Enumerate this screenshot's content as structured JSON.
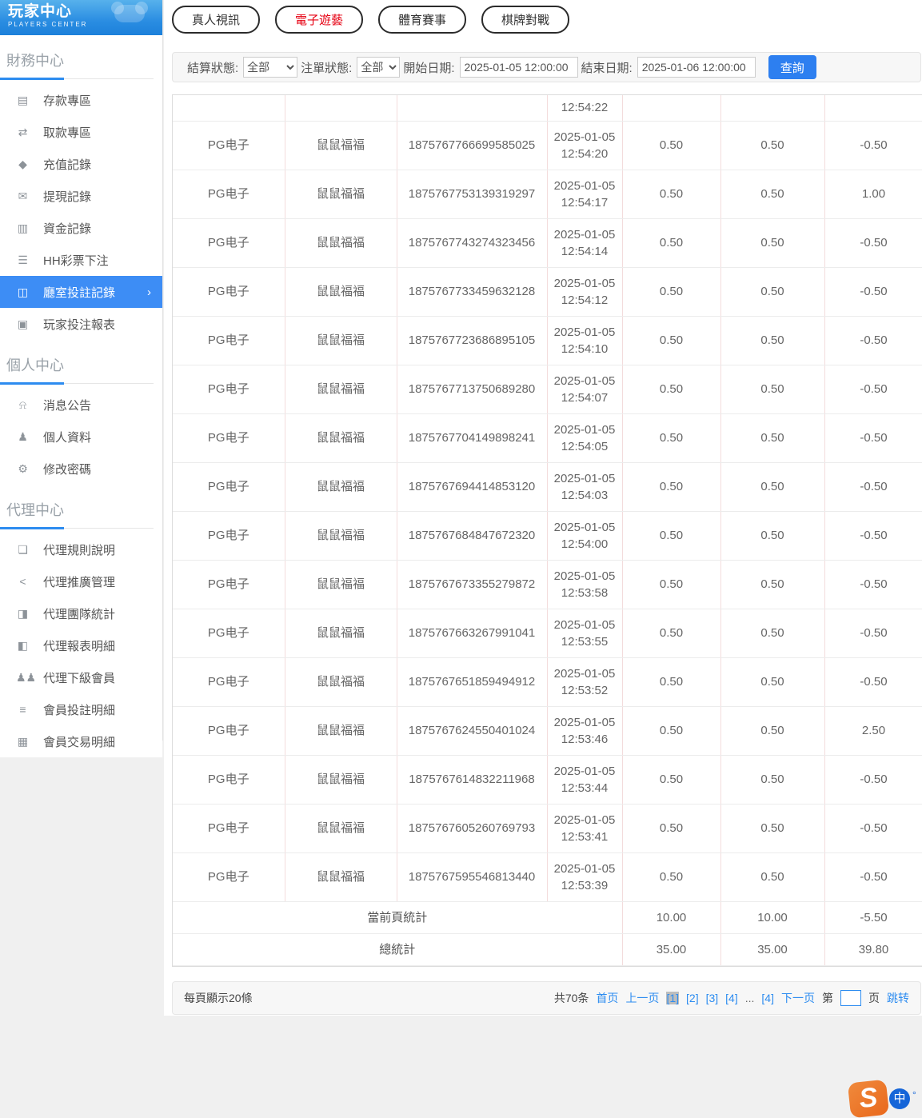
{
  "brand": {
    "title": "玩家中心",
    "subtitle": "PLAYERS CENTER"
  },
  "sidebar": {
    "sections": [
      {
        "title": "財務中心",
        "items": [
          {
            "id": "deposit",
            "label": "存款專區",
            "icon": "bank-card-icon",
            "active": false
          },
          {
            "id": "withdraw",
            "label": "取款專區",
            "icon": "hand-money-icon",
            "active": false
          },
          {
            "id": "recharge-record",
            "label": "充值記錄",
            "icon": "money-bag-icon",
            "active": false
          },
          {
            "id": "withdraw-record",
            "label": "提現記錄",
            "icon": "wallet-icon",
            "active": false
          },
          {
            "id": "funds-record",
            "label": "資金記錄",
            "icon": "coin-purse-icon",
            "active": false
          },
          {
            "id": "hh-lottery",
            "label": "HH彩票下注",
            "icon": "ticket-list-icon",
            "active": false
          },
          {
            "id": "hall-bet-record",
            "label": "廳室投註記錄",
            "icon": "layout-list-icon",
            "active": true
          },
          {
            "id": "player-bet-report",
            "label": "玩家投注報表",
            "icon": "report-chart-icon",
            "active": false
          }
        ]
      },
      {
        "title": "個人中心",
        "items": [
          {
            "id": "messages",
            "label": "消息公告",
            "icon": "bell-icon",
            "active": false
          },
          {
            "id": "profile",
            "label": "個人資料",
            "icon": "person-icon",
            "active": false
          },
          {
            "id": "change-password",
            "label": "修改密碼",
            "icon": "gear-icon",
            "active": false
          }
        ]
      },
      {
        "title": "代理中心",
        "items": [
          {
            "id": "agent-rules",
            "label": "代理規則說明",
            "icon": "document-icon",
            "active": false
          },
          {
            "id": "agent-promotion",
            "label": "代理推廣管理",
            "icon": "share-icon",
            "active": false
          },
          {
            "id": "agent-team-stats",
            "label": "代理團隊統計",
            "icon": "team-stats-icon",
            "active": false
          },
          {
            "id": "agent-report-detail",
            "label": "代理報表明細",
            "icon": "report-detail-icon",
            "active": false
          },
          {
            "id": "agent-sub-members",
            "label": "代理下級會員",
            "icon": "users-icon",
            "active": false
          },
          {
            "id": "member-bet-detail",
            "label": "會員投註明細",
            "icon": "clipboard-list-icon",
            "active": false
          },
          {
            "id": "member-transaction-detail",
            "label": "會員交易明細",
            "icon": "ledger-icon",
            "active": false
          }
        ]
      }
    ]
  },
  "tabs": [
    {
      "id": "live-video",
      "label": "真人視訊",
      "active": false
    },
    {
      "id": "electronic-games",
      "label": "電子遊藝",
      "active": true
    },
    {
      "id": "sports",
      "label": "體育賽事",
      "active": false
    },
    {
      "id": "board-games",
      "label": "棋牌對戰",
      "active": false
    }
  ],
  "filters": {
    "settle_label": "結算狀態:",
    "settle_value": "全部",
    "order_label": "注單狀態:",
    "order_value": "全部",
    "start_label": "開始日期:",
    "start_value": "2025-01-05 12:00:00",
    "end_label": "結束日期:",
    "end_value": "2025-01-06 12:00:00",
    "search_label": "查詢"
  },
  "table": {
    "partial_row_time": "12:54:22",
    "rows": [
      {
        "game": "PG电子",
        "name": "鼠鼠福福",
        "order": "1875767766699585025",
        "date": "2025-01-05",
        "time": "12:54:20",
        "bet": "0.50",
        "valid": "0.50",
        "payout": "-0.50"
      },
      {
        "game": "PG电子",
        "name": "鼠鼠福福",
        "order": "1875767753139319297",
        "date": "2025-01-05",
        "time": "12:54:17",
        "bet": "0.50",
        "valid": "0.50",
        "payout": "1.00"
      },
      {
        "game": "PG电子",
        "name": "鼠鼠福福",
        "order": "1875767743274323456",
        "date": "2025-01-05",
        "time": "12:54:14",
        "bet": "0.50",
        "valid": "0.50",
        "payout": "-0.50"
      },
      {
        "game": "PG电子",
        "name": "鼠鼠福福",
        "order": "1875767733459632128",
        "date": "2025-01-05",
        "time": "12:54:12",
        "bet": "0.50",
        "valid": "0.50",
        "payout": "-0.50"
      },
      {
        "game": "PG电子",
        "name": "鼠鼠福福",
        "order": "1875767723686895105",
        "date": "2025-01-05",
        "time": "12:54:10",
        "bet": "0.50",
        "valid": "0.50",
        "payout": "-0.50"
      },
      {
        "game": "PG电子",
        "name": "鼠鼠福福",
        "order": "1875767713750689280",
        "date": "2025-01-05",
        "time": "12:54:07",
        "bet": "0.50",
        "valid": "0.50",
        "payout": "-0.50"
      },
      {
        "game": "PG电子",
        "name": "鼠鼠福福",
        "order": "1875767704149898241",
        "date": "2025-01-05",
        "time": "12:54:05",
        "bet": "0.50",
        "valid": "0.50",
        "payout": "-0.50"
      },
      {
        "game": "PG电子",
        "name": "鼠鼠福福",
        "order": "1875767694414853120",
        "date": "2025-01-05",
        "time": "12:54:03",
        "bet": "0.50",
        "valid": "0.50",
        "payout": "-0.50"
      },
      {
        "game": "PG电子",
        "name": "鼠鼠福福",
        "order": "1875767684847672320",
        "date": "2025-01-05",
        "time": "12:54:00",
        "bet": "0.50",
        "valid": "0.50",
        "payout": "-0.50"
      },
      {
        "game": "PG电子",
        "name": "鼠鼠福福",
        "order": "1875767673355279872",
        "date": "2025-01-05",
        "time": "12:53:58",
        "bet": "0.50",
        "valid": "0.50",
        "payout": "-0.50"
      },
      {
        "game": "PG电子",
        "name": "鼠鼠福福",
        "order": "1875767663267991041",
        "date": "2025-01-05",
        "time": "12:53:55",
        "bet": "0.50",
        "valid": "0.50",
        "payout": "-0.50"
      },
      {
        "game": "PG电子",
        "name": "鼠鼠福福",
        "order": "1875767651859494912",
        "date": "2025-01-05",
        "time": "12:53:52",
        "bet": "0.50",
        "valid": "0.50",
        "payout": "-0.50"
      },
      {
        "game": "PG电子",
        "name": "鼠鼠福福",
        "order": "1875767624550401024",
        "date": "2025-01-05",
        "time": "12:53:46",
        "bet": "0.50",
        "valid": "0.50",
        "payout": "2.50"
      },
      {
        "game": "PG电子",
        "name": "鼠鼠福福",
        "order": "1875767614832211968",
        "date": "2025-01-05",
        "time": "12:53:44",
        "bet": "0.50",
        "valid": "0.50",
        "payout": "-0.50"
      },
      {
        "game": "PG电子",
        "name": "鼠鼠福福",
        "order": "1875767605260769793",
        "date": "2025-01-05",
        "time": "12:53:41",
        "bet": "0.50",
        "valid": "0.50",
        "payout": "-0.50"
      },
      {
        "game": "PG电子",
        "name": "鼠鼠福福",
        "order": "1875767595546813440",
        "date": "2025-01-05",
        "time": "12:53:39",
        "bet": "0.50",
        "valid": "0.50",
        "payout": "-0.50"
      }
    ],
    "summary": [
      {
        "label": "當前頁統計",
        "bet": "10.00",
        "valid": "10.00",
        "payout": "-5.50"
      },
      {
        "label": "總統計",
        "bet": "35.00",
        "valid": "35.00",
        "payout": "39.80"
      }
    ]
  },
  "pagination": {
    "page_size_text": "每頁顯示20條",
    "total_text": "共70条",
    "first": "首页",
    "prev": "上一页",
    "pages": [
      "[1]",
      "[2]",
      "[3]",
      "[4]"
    ],
    "ellipsis": "...",
    "last_page": "[4]",
    "next": "下一页",
    "jump_prefix": "第",
    "jump_suffix": "页",
    "jump_action": "跳转"
  },
  "widget": {
    "s_label": "S",
    "zhong_label": "中",
    "marks": "°"
  },
  "colors": {
    "accent_blue": "#2d8cf0",
    "active_item_blue": "#3d8df5",
    "button_blue": "#2d7ff0",
    "active_tab_red": "#e60012",
    "header_gradient_top": "#57b1ec",
    "header_gradient_bottom": "#1c80da"
  }
}
